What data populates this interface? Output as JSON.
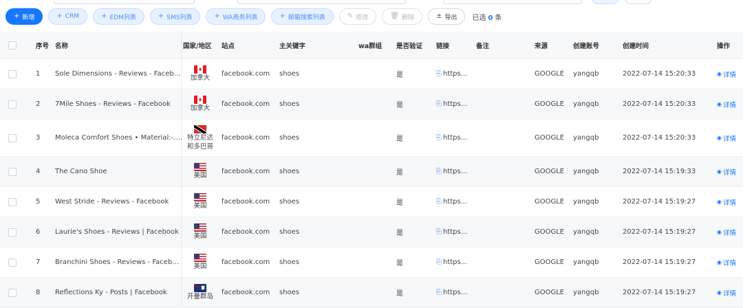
{
  "toolbar": {
    "add_label": "新增",
    "crm_label": "CRM",
    "edm_label": "EDM列表",
    "sms_label": "SMS列表",
    "wa_label": "WA商务列表",
    "mail_label": "邮箱搜索列表",
    "edit_label": "修改",
    "delete_label": "删除",
    "export_label": "导出",
    "selected_prefix": "已选",
    "selected_count": "0",
    "selected_suffix": "条"
  },
  "table": {
    "headers": {
      "no": "序号",
      "name": "名称",
      "country": "国家/地区",
      "site": "站点",
      "keyword": "主关键字",
      "wa": "wa群组",
      "verified": "是否验证",
      "link": "链接",
      "note": "备注",
      "source": "来源",
      "account": "创建账号",
      "created": "创建时间",
      "action": "操作"
    },
    "rows": [
      {
        "no": "1",
        "name": "Sole Dimensions - Reviews - Facebook",
        "flag": "canada-flag",
        "country": "加拿大",
        "site": "facebook.com",
        "keyword": "shoes",
        "wa": "",
        "verified": "是",
        "link": "https...",
        "note": "",
        "source": "GOOGLE",
        "account": "yangqb",
        "created": "2022-07-14 15:20:33",
        "action": "详情"
      },
      {
        "no": "2",
        "name": "7Mile Shoes - Reviews - Facebook",
        "flag": "canada-flag",
        "country": "加拿大",
        "site": "facebook.com",
        "keyword": "shoes",
        "wa": "",
        "verified": "是",
        "link": "https...",
        "note": "",
        "source": "GOOGLE",
        "account": "yangqb",
        "created": "2022-07-14 15:20:33",
        "action": "详情"
      },
      {
        "no": "3",
        "name": "Moleca Comfort Shoes • Material:-... ...",
        "flag": "trinidad-flag",
        "country_line1": "特立尼达",
        "country_line2": "和多巴哥",
        "site": "facebook.com",
        "keyword": "shoes",
        "wa": "",
        "verified": "是",
        "link": "https...",
        "note": "",
        "source": "GOOGLE",
        "account": "yangqb",
        "created": "2022-07-14 15:20:33",
        "action": "详情"
      },
      {
        "no": "4",
        "name": "The Cano Shoe",
        "flag": "usa-flag",
        "country": "美国",
        "site": "facebook.com",
        "keyword": "shoes",
        "wa": "",
        "verified": "是",
        "link": "https...",
        "note": "",
        "source": "GOOGLE",
        "account": "yangqb",
        "created": "2022-07-14 15:19:33",
        "action": "详情"
      },
      {
        "no": "5",
        "name": "West Stride - Reviews - Facebook",
        "flag": "usa-flag",
        "country": "美国",
        "site": "facebook.com",
        "keyword": "shoes",
        "wa": "",
        "verified": "是",
        "link": "https...",
        "note": "",
        "source": "GOOGLE",
        "account": "yangqb",
        "created": "2022-07-14 15:19:27",
        "action": "详情"
      },
      {
        "no": "6",
        "name": "Laurie's Shoes - Reviews | Facebook",
        "flag": "usa-flag",
        "country": "美国",
        "site": "facebook.com",
        "keyword": "shoes",
        "wa": "",
        "verified": "是",
        "link": "https...",
        "note": "",
        "source": "GOOGLE",
        "account": "yangqb",
        "created": "2022-07-14 15:19:27",
        "action": "详情"
      },
      {
        "no": "7",
        "name": "Branchini Shoes - Reviews - Facebook",
        "flag": "usa-flag",
        "country": "美国",
        "site": "facebook.com",
        "keyword": "shoes",
        "wa": "",
        "verified": "是",
        "link": "https...",
        "note": "",
        "source": "GOOGLE",
        "account": "yangqb",
        "created": "2022-07-14 15:19:27",
        "action": "详情"
      },
      {
        "no": "8",
        "name": "Reflections Ky - Posts | Facebook",
        "flag": "cayman-flag",
        "country": "开曼群岛",
        "site": "facebook.com",
        "keyword": "shoes",
        "wa": "",
        "verified": "是",
        "link": "https...",
        "note": "",
        "source": "GOOGLE",
        "account": "yangqb",
        "created": "2022-07-14 15:19:27",
        "action": "详情"
      }
    ]
  },
  "colors": {
    "primary": "#1677ff",
    "soft_bg": "#e8f1ff",
    "header_bg": "#f7f8fa"
  }
}
